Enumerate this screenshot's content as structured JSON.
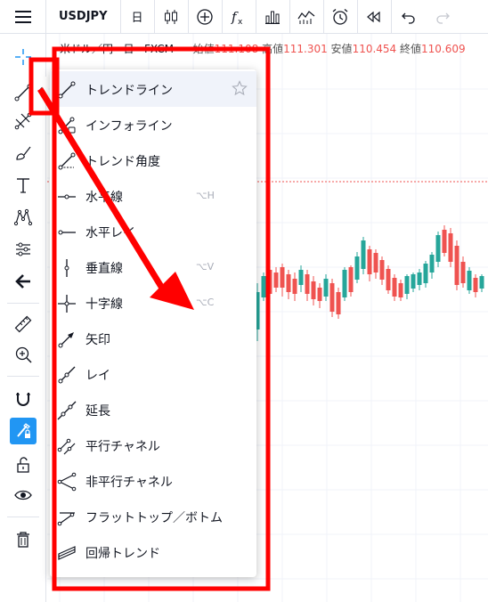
{
  "toolbar": {
    "symbol": "USDJPY",
    "interval": "日"
  },
  "legend": {
    "title": "米ドル／円",
    "interval": "日",
    "source": "FXCM",
    "open_label": "始値",
    "open_value": "111.108",
    "high_label": "高値",
    "high_value": "111.301",
    "low_label": "安値",
    "low_value": "110.454",
    "close_label": "終値",
    "close_value": "110.609"
  },
  "flyout": {
    "collapse_glyph": "‹",
    "items": [
      {
        "label": "トレンドライン",
        "hotkey": "",
        "icon": "trend-line-icon",
        "active": true
      },
      {
        "label": "インフォライン",
        "hotkey": "",
        "icon": "info-line-icon"
      },
      {
        "label": "トレンド角度",
        "hotkey": "",
        "icon": "trend-angle-icon"
      },
      {
        "label": "水平線",
        "hotkey": "⌥H",
        "icon": "horizontal-line-icon"
      },
      {
        "label": "水平レイ",
        "hotkey": "",
        "icon": "horizontal-ray-icon"
      },
      {
        "label": "垂直線",
        "hotkey": "⌥V",
        "icon": "vertical-line-icon"
      },
      {
        "label": "十字線",
        "hotkey": "⌥C",
        "icon": "cross-line-icon"
      },
      {
        "label": "矢印",
        "hotkey": "",
        "icon": "arrow-icon"
      },
      {
        "label": "レイ",
        "hotkey": "",
        "icon": "ray-icon"
      },
      {
        "label": "延長",
        "hotkey": "",
        "icon": "extended-line-icon"
      },
      {
        "label": "平行チャネル",
        "hotkey": "",
        "icon": "parallel-channel-icon"
      },
      {
        "label": "非平行チャネル",
        "hotkey": "",
        "icon": "disjoint-channel-icon"
      },
      {
        "label": "フラットトップ／ボトム",
        "hotkey": "",
        "icon": "flat-top-bottom-icon"
      },
      {
        "label": "回帰トレンド",
        "hotkey": "",
        "icon": "regression-trend-icon"
      }
    ]
  },
  "colors": {
    "accent": "#2196f3",
    "up": "#26a69a",
    "down": "#ef5350",
    "annotation": "#ff0000"
  }
}
